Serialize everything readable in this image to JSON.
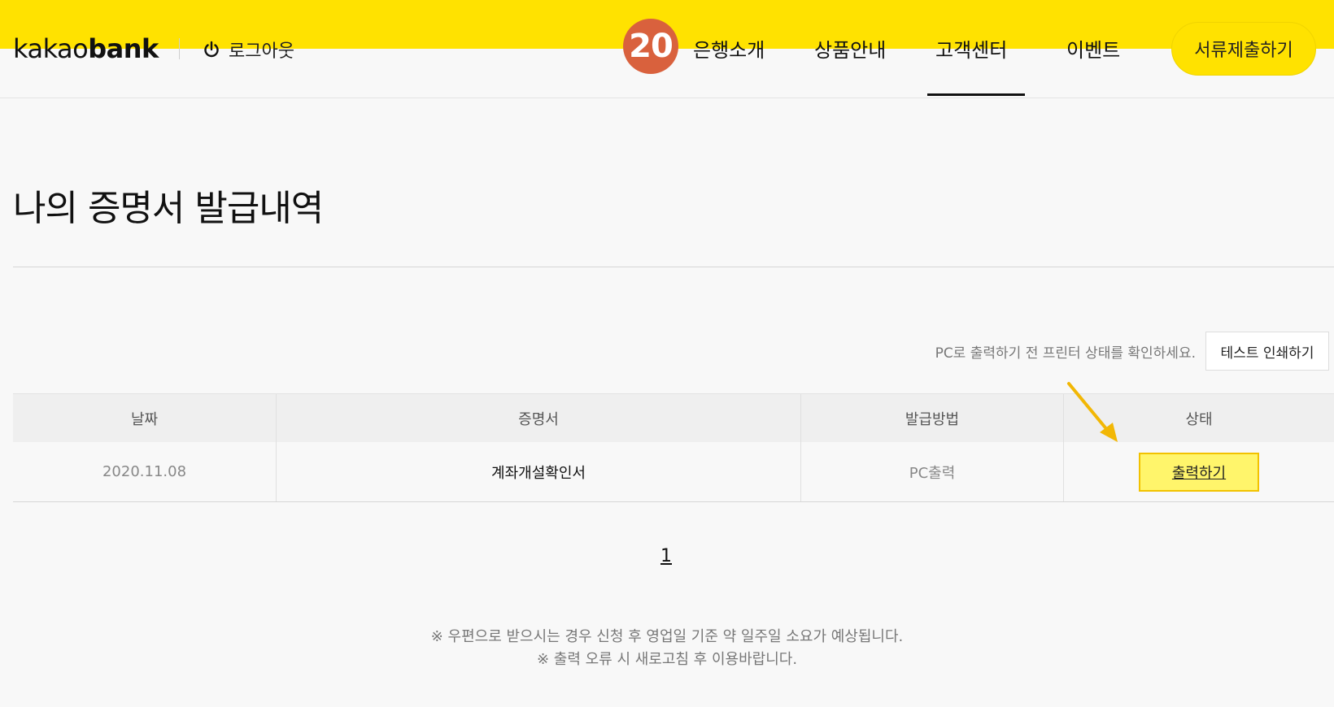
{
  "header": {
    "logo_text": "kakaobank",
    "logo_light": "kakao",
    "logo_bold": "bank",
    "logout_label": "로그아웃",
    "badge_number": "20",
    "nav": [
      {
        "label": "은행소개",
        "active": false
      },
      {
        "label": "상품안내",
        "active": false
      },
      {
        "label": "고객센터",
        "active": true
      },
      {
        "label": "이벤트",
        "active": false
      }
    ],
    "submit_label": "서류제출하기"
  },
  "main": {
    "title": "나의 증명서 발급내역",
    "printer_notice": "PC로 출력하기 전 프린터 상태를 확인하세요.",
    "test_print_label": "테스트 인쇄하기",
    "table": {
      "headers": [
        "날짜",
        "증명서",
        "발급방법",
        "상태"
      ],
      "rows": [
        {
          "date": "2020.11.08",
          "certificate": "계좌개설확인서",
          "method": "PC출력",
          "status": "출력하기"
        }
      ]
    },
    "pagination": {
      "current": "1"
    },
    "footnotes": [
      "※ 우편으로 받으시는 경우 신청 후 영업일 기준 약 일주일 소요가 예상됩니다.",
      "※ 출력 오류 시 새로고침 후 이용바랍니다."
    ]
  },
  "colors": {
    "brand_yellow": "#ffe200",
    "badge_orange": "#d9613d",
    "highlight_yellow": "#fff56b",
    "arrow": "#f2b705"
  },
  "icons": {
    "logout": "power-icon",
    "annotation": "arrow-icon"
  }
}
